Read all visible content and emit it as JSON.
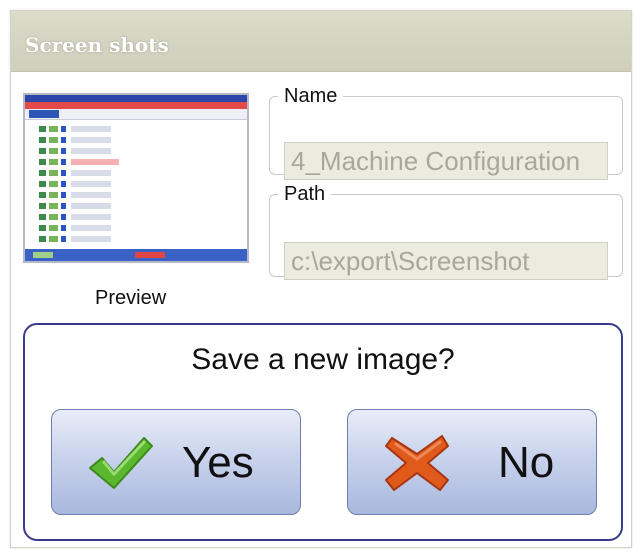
{
  "window": {
    "title": "Screen shots"
  },
  "preview": {
    "label": "Preview"
  },
  "name": {
    "legend": "Name",
    "value": "4_Machine Configuration"
  },
  "path": {
    "legend": "Path",
    "value": "c:\\export\\Screenshot"
  },
  "dialog": {
    "question": "Save a new image?",
    "yes_label": "Yes",
    "no_label": "No"
  },
  "colors": {
    "accent": "#3b3b8d",
    "yes_icon": "#5bb82e",
    "no_icon": "#e05a1c"
  }
}
